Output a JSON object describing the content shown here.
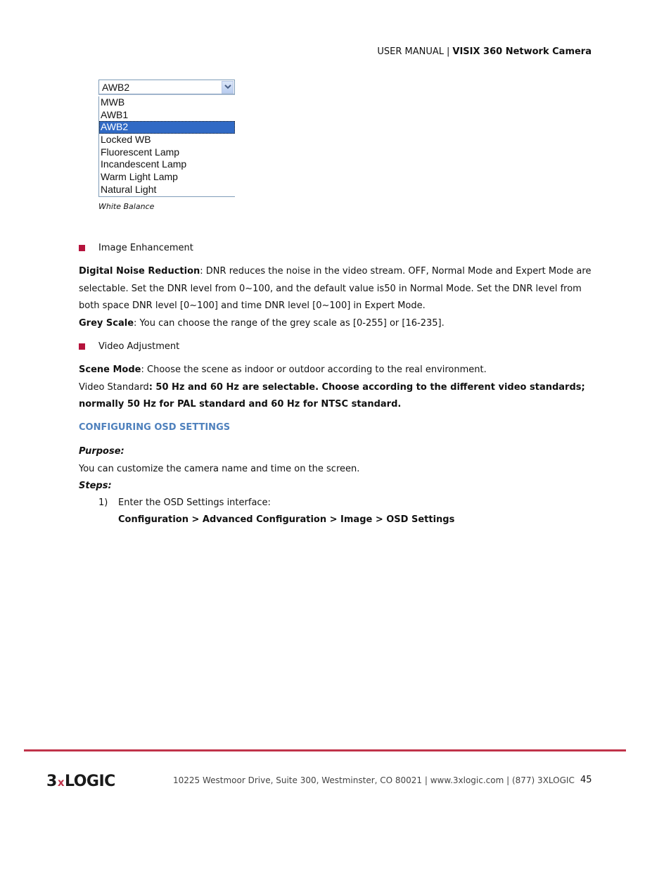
{
  "header": {
    "manual_label": "USER MANUAL",
    "separator": "|",
    "product": "VISIX 360 Network Camera"
  },
  "dropdown": {
    "selected_value": "AWB2",
    "options": [
      {
        "label": "MWB",
        "selected": false
      },
      {
        "label": "AWB1",
        "selected": false
      },
      {
        "label": "AWB2",
        "selected": true
      },
      {
        "label": "Locked WB",
        "selected": false
      },
      {
        "label": "Fluorescent Lamp",
        "selected": false
      },
      {
        "label": "Incandescent Lamp",
        "selected": false
      },
      {
        "label": "Warm Light Lamp",
        "selected": false
      },
      {
        "label": "Natural Light",
        "selected": false
      }
    ],
    "caption": "White Balance",
    "highlight_color": "#316ac5"
  },
  "sections": {
    "image_enhancement": {
      "bullet": "Image Enhancement",
      "dnr_term": "Digital Noise Reduction",
      "dnr_text": ": DNR reduces the noise in the video stream. OFF, Normal Mode and Expert Mode are selectable. Set the DNR level from 0~100, and the default value is50 in Normal Mode. Set the DNR level from both space DNR level [0~100] and time DNR level [0~100] in Expert Mode.",
      "grey_term": "Grey Scale",
      "grey_text": ": You can choose the range of the grey scale as [0-255] or [16-235]."
    },
    "video_adjustment": {
      "bullet": "Video Adjustment",
      "scene_term": "Scene Mode",
      "scene_text": ": Choose the scene as indoor or outdoor according to the real environment.",
      "standard_term": "Video Standard",
      "standard_text": ": 50 Hz and 60 Hz are selectable. Choose according to the different video standards; normally 50 Hz for PAL standard and 60 Hz for NTSC standard."
    },
    "osd": {
      "heading": "CONFIGURING OSD SETTINGS",
      "purpose_label": "Purpose:",
      "purpose_text": "You can customize the camera name and time on the screen.",
      "steps_label": "Steps:",
      "steps": [
        {
          "num": "1)",
          "text": "Enter the OSD Settings interface:"
        }
      ],
      "path": "Configuration > Advanced Configuration > Image > OSD Settings"
    }
  },
  "footer": {
    "logo_left": "3",
    "logo_x": "x",
    "logo_right": "LOGIC",
    "address": "10225 Westmoor Drive, Suite 300, Westminster, CO 80021 | www.3xlogic.com | (877) 3XLOGIC",
    "page_number": "45"
  },
  "colors": {
    "bullet": "#b5133c",
    "heading": "#4f81bd",
    "footer_rule": "#c0334a"
  }
}
